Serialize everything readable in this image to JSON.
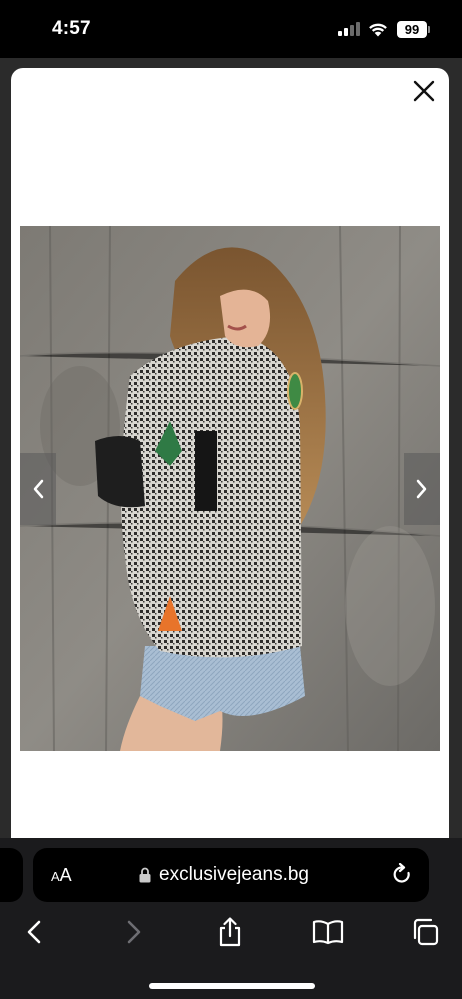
{
  "status_bar": {
    "time": "4:57",
    "battery": "99",
    "icons": [
      "signal-icon",
      "wifi-icon",
      "battery-icon"
    ]
  },
  "modal": {
    "close_icon": "close-icon",
    "photo_alt": "Model in houndstooth blazer with patches and denim shorts",
    "prev_icon": "chevron-left-icon",
    "next_icon": "chevron-right-icon"
  },
  "address_bar": {
    "reader_label": "AA",
    "url": "exclusivejeans.bg",
    "lock_icon": "lock-icon",
    "reload_icon": "reload-icon"
  },
  "toolbar": {
    "buttons": [
      "back-icon",
      "forward-icon",
      "share-icon",
      "bookmarks-icon",
      "tabs-icon"
    ]
  },
  "colors": {
    "status_bg": "#000000",
    "modal_bg": "#ffffff",
    "browser_bar": "#1b1b1d",
    "address_bg": "#000000"
  }
}
